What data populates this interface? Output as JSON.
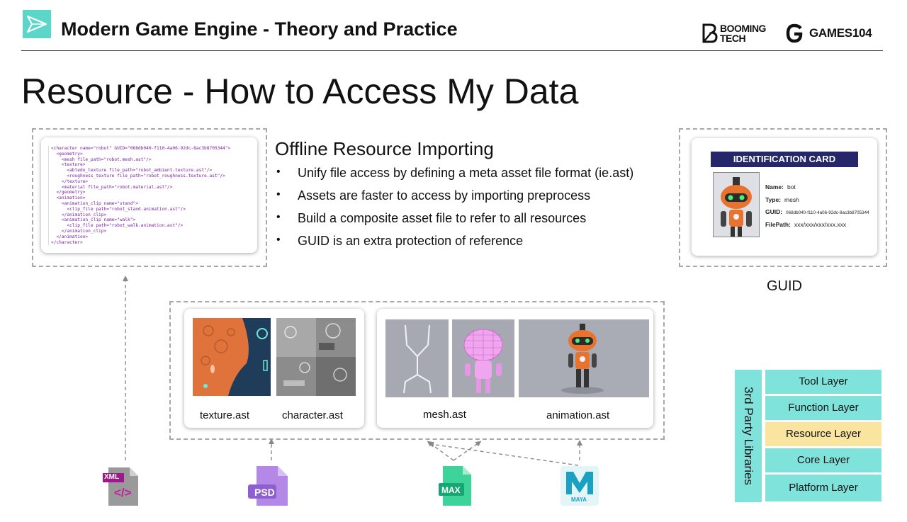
{
  "header": {
    "course_title": "Modern Game Engine - Theory and Practice",
    "brand_booming_line1": "BOOMING",
    "brand_booming_line2": "TECH",
    "brand_games": "GAMES104"
  },
  "page_title": "Resource - How to Access My Data",
  "section": {
    "heading": "Offline Resource Importing",
    "bullets": [
      "Unify file access by defining a meta asset file format (ie.ast)",
      "Assets are faster to access by importing preprocess",
      "Build a composite asset file to refer to all resources",
      "GUID is an extra protection of reference"
    ]
  },
  "xml_lines": [
    "<character name=\"robot\" GUID=\"068db040-f110-4a06-92dc-8ac3b8705344\">",
    "  <geometry>",
    "    <mesh file_path=\"robot.mesh.ast\"/>",
    "    <texture>",
    "      <abledo_texture file_path=\"robot_ambient.texture.ast\"/>",
    "      <roughness_texture file_path=\"robot_roughness.texture.ast\"/>",
    "    </texture>",
    "    <material file_path=\"robot.material.ast\"/>",
    "  </geometry>",
    "  <animation>",
    "    <animation_clip name=\"stand\">",
    "      <clip_file path=\"robot_stand.animation.ast\"/>",
    "    </animation_clip>",
    "    <animation_clip name=\"walk\">",
    "      <clip_file path=\"robot_walk.animation.ast\"/>",
    "    </animation_clip>",
    "  </animation>",
    "</character>"
  ],
  "id_card": {
    "header": "IDENTIFICATION CARD",
    "name_label": "Name:",
    "name_value": "bot",
    "type_label": "Type:",
    "type_value": "mesh",
    "guid_label": "GUID:",
    "guid_value": "068db040-f110-4a06-92dc-8ac3b8705344",
    "filepath_label": "FilePath:",
    "filepath_value": "xxx/xxx/xxx/xxx.xxx"
  },
  "guid_caption": "GUID",
  "assets": {
    "texture": "texture.ast",
    "character": "character.ast",
    "mesh": "mesh.ast",
    "animation": "animation.ast"
  },
  "file_icons": {
    "xml": "XML",
    "xml_glyph": "</>",
    "psd": "PSD",
    "max": "MAX",
    "maya": "MAYA"
  },
  "layers": {
    "libraries": "3rd Party Libraries",
    "items": [
      "Tool Layer",
      "Function Layer",
      "Resource Layer",
      "Core Layer",
      "Platform Layer"
    ],
    "highlighted": "Resource Layer"
  },
  "colors": {
    "layer_teal": "#7fe3dc",
    "layer_highlight": "#f9e4a0",
    "card_header_navy": "#26266a",
    "logo_teal": "#5cd6c9"
  }
}
